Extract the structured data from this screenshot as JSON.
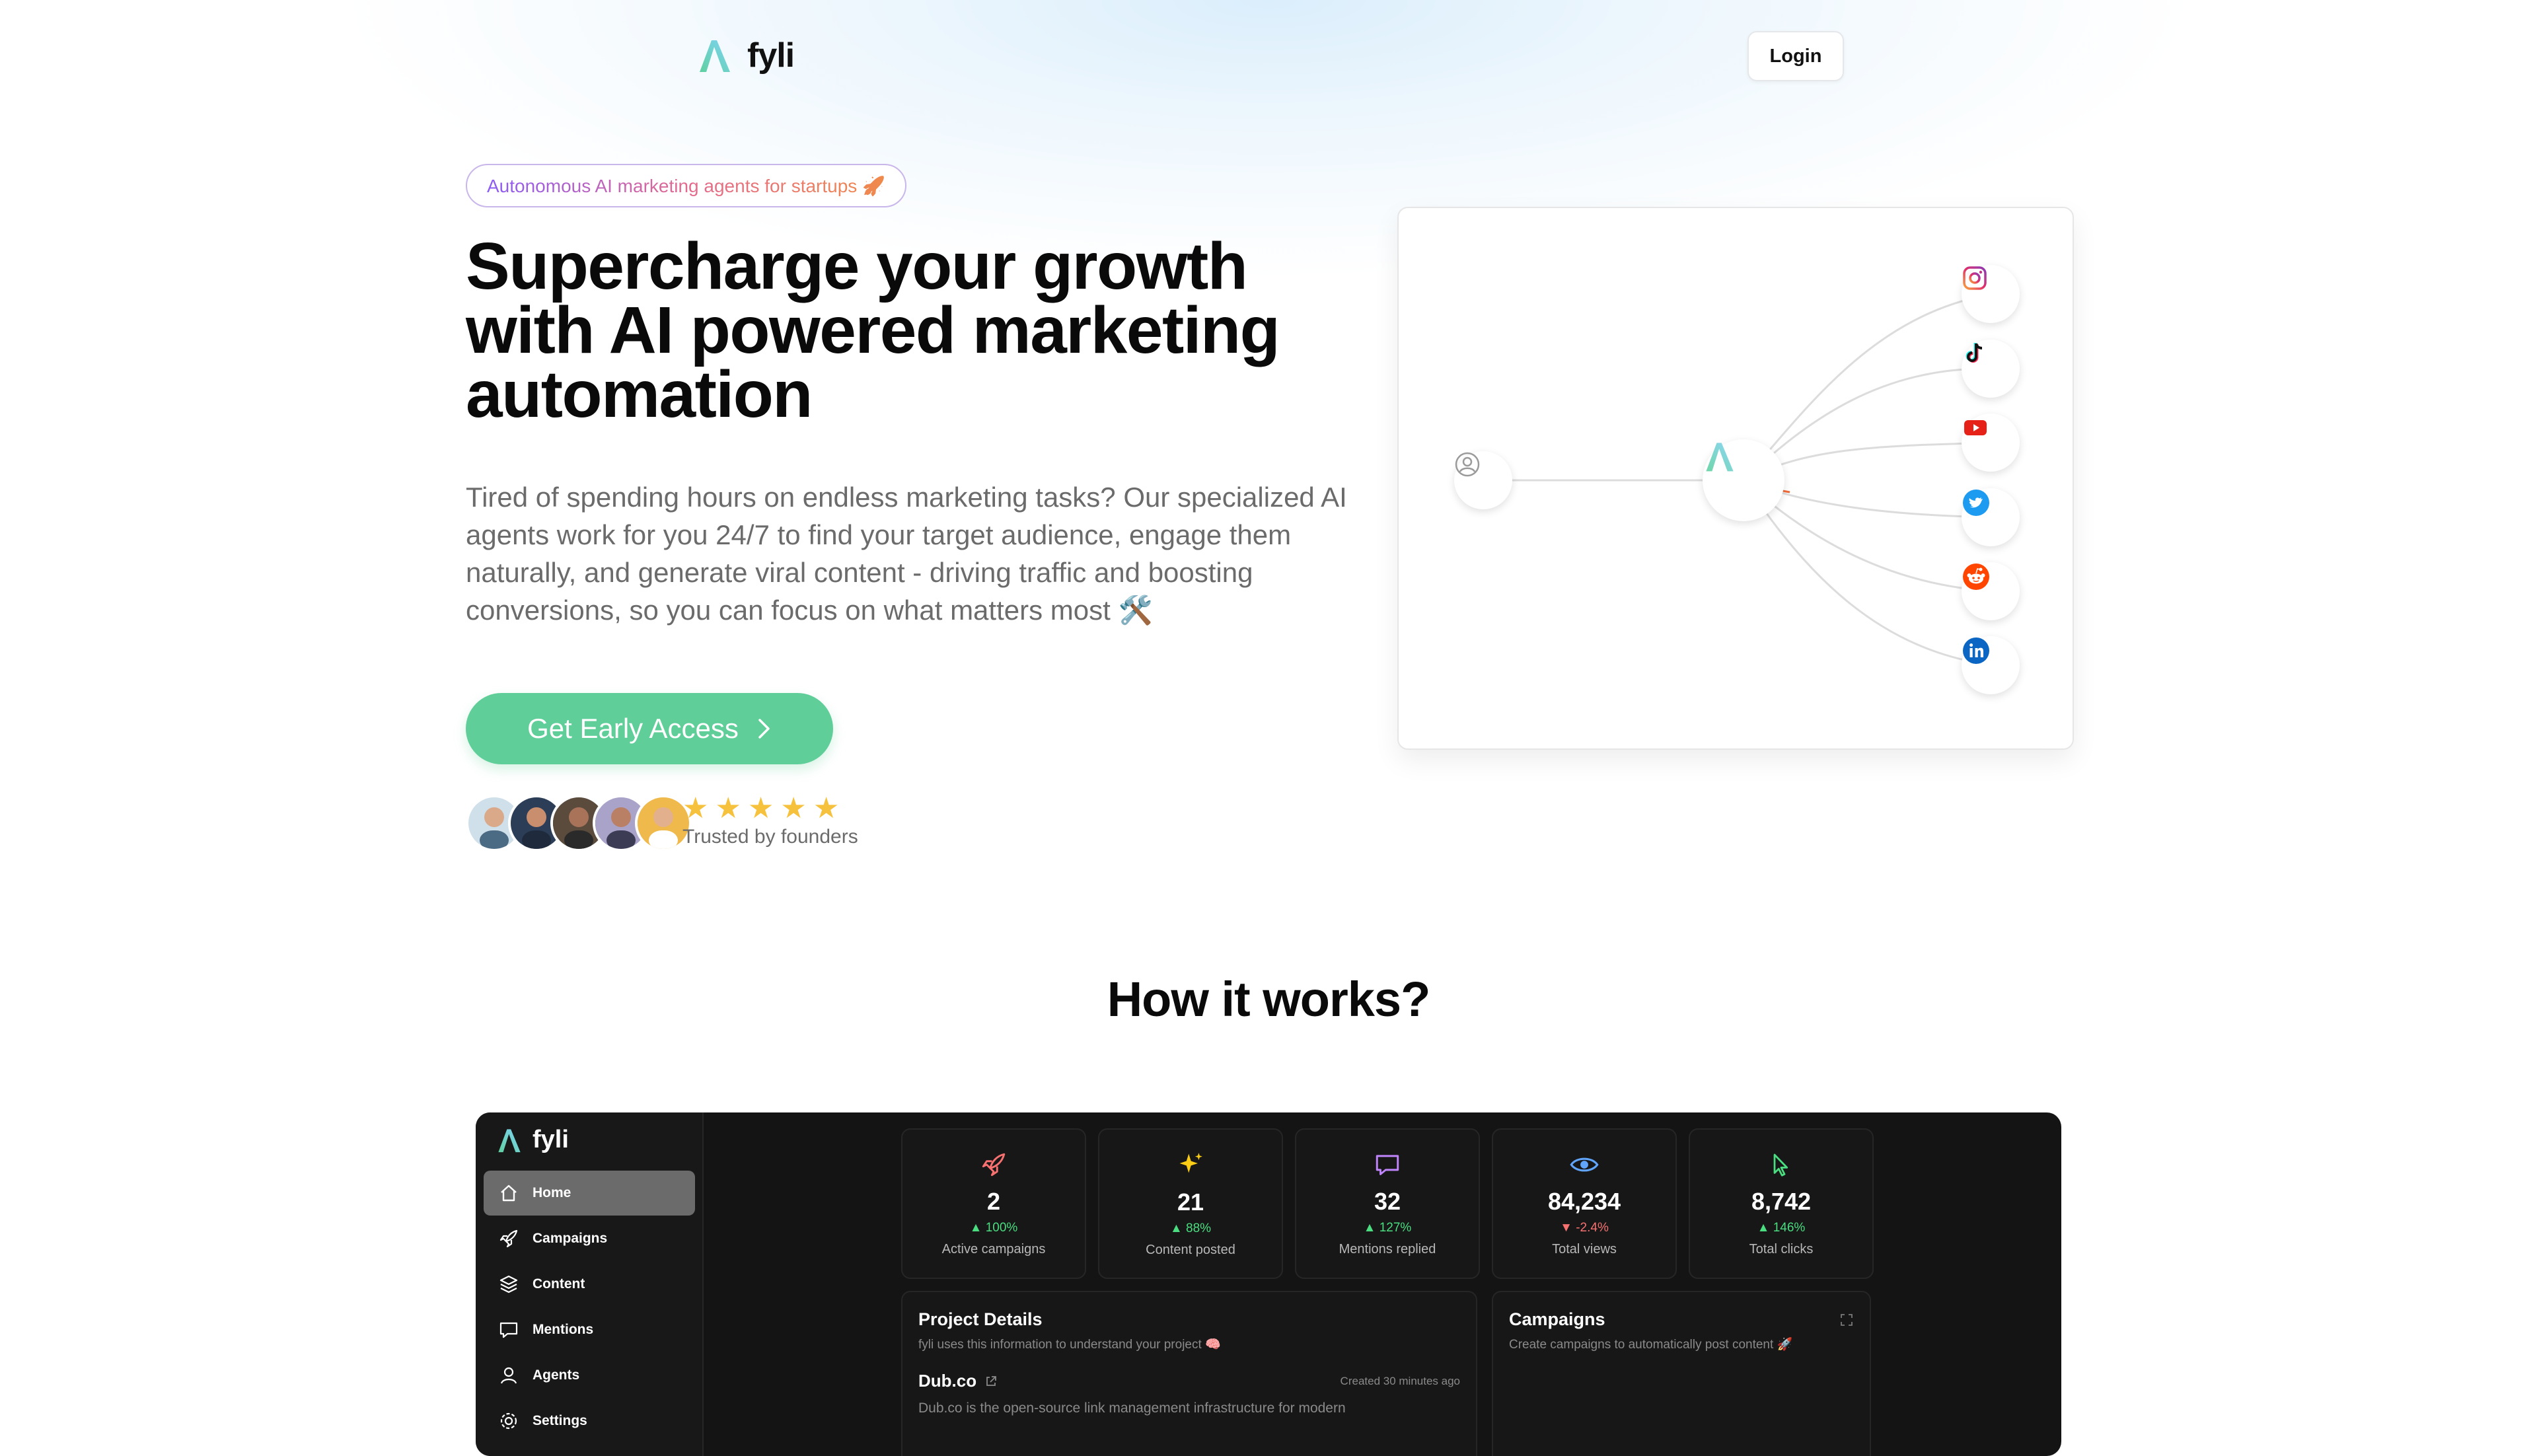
{
  "nav": {
    "brand": "fyli",
    "login_label": "Login"
  },
  "hero": {
    "badge": "Autonomous AI marketing agents for startups 🚀",
    "title": "Supercharge your growth with AI powered marketing automation",
    "description": "Tired of spending hours on endless marketing tasks? Our specialized AI agents work for you 24/7 to find your target audience, engage them naturally, and generate viral content - driving traffic and boosting conversions, so you can focus on what matters most 🛠️",
    "cta_label": "Get Early Access",
    "rating_stars": 5,
    "social_proof": "Trusted by founders"
  },
  "flow": {
    "input_icon": "user-circle-icon",
    "center_icon": "fyli-logo-icon",
    "channels": [
      "instagram-icon",
      "tiktok-icon",
      "youtube-icon",
      "twitter-icon",
      "reddit-icon",
      "linkedin-icon"
    ]
  },
  "how_it_works": {
    "title": "How it works?"
  },
  "dashboard": {
    "brand": "fyli",
    "sidebar": [
      {
        "label": "Home",
        "icon": "home-icon",
        "active": true
      },
      {
        "label": "Campaigns",
        "icon": "rocket-icon"
      },
      {
        "label": "Content",
        "icon": "layers-icon"
      },
      {
        "label": "Mentions",
        "icon": "message-icon"
      },
      {
        "label": "Agents",
        "icon": "user-icon"
      },
      {
        "label": "Settings",
        "icon": "gear-icon"
      }
    ],
    "stats": [
      {
        "value": "2",
        "delta": "100%",
        "trend": "up",
        "label": "Active campaigns",
        "icon": "rocket-icon",
        "color": "#f87171"
      },
      {
        "value": "21",
        "delta": "88%",
        "trend": "up",
        "label": "Content posted",
        "icon": "sparkles-icon",
        "color": "#facc15"
      },
      {
        "value": "32",
        "delta": "127%",
        "trend": "up",
        "label": "Mentions replied",
        "icon": "message-icon",
        "color": "#c084fc"
      },
      {
        "value": "84,234",
        "delta": "-2.4%",
        "trend": "down",
        "label": "Total views",
        "icon": "eye-icon",
        "color": "#60a5fa"
      },
      {
        "value": "8,742",
        "delta": "146%",
        "trend": "up",
        "label": "Total clicks",
        "icon": "cursor-icon",
        "color": "#4ade80"
      }
    ],
    "project": {
      "title": "Project Details",
      "subtitle": "fyli uses this information to understand your project 🧠",
      "name": "Dub.co",
      "created": "Created 30 minutes ago",
      "description": "Dub.co is the open-source link management infrastructure for modern"
    },
    "campaigns": {
      "title": "Campaigns",
      "subtitle": "Create campaigns to automatically post content 🚀"
    }
  }
}
